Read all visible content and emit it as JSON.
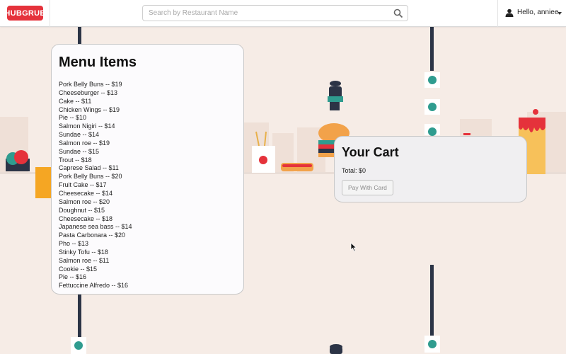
{
  "navbar": {
    "logo_text": "HUBGRUB",
    "search_placeholder": "Search by Restaurant Name",
    "search_icon": "search-icon",
    "user_icon": "user-icon",
    "user_greeting": "Hello, anniee",
    "dropdown_icon": "caret-down-icon"
  },
  "menu": {
    "title": "Menu Items",
    "items": [
      "Pork Belly Buns -- $19",
      "Cheeseburger -- $13",
      "Cake -- $11",
      "Chicken Wings -- $19",
      "Pie -- $10",
      "Salmon Nigiri -- $14",
      "Sundae -- $14",
      "Salmon roe -- $19",
      "Sundae -- $15",
      "Trout -- $18",
      "Caprese Salad -- $11",
      "Pork Belly Buns -- $20",
      "Fruit Cake -- $17",
      "Cheesecake -- $14",
      "Salmon roe -- $20",
      "Doughnut -- $15",
      "Cheesecake -- $18",
      "Japanese sea bass -- $14",
      "Pasta Carbonara -- $20",
      "Pho -- $13",
      "Stinky Tofu -- $18",
      "Salmon roe -- $11",
      "Cookie -- $15",
      "Pie -- $16",
      "Fettuccine Alfredo -- $16"
    ]
  },
  "cart": {
    "title": "Your Cart",
    "total": "Total: $0",
    "pay_button": "Pay With Card"
  },
  "colors": {
    "brand": "#e5323b",
    "background": "#f6ece6",
    "teal_accent": "#2f9c8f",
    "navy_pole": "#2c3446"
  }
}
